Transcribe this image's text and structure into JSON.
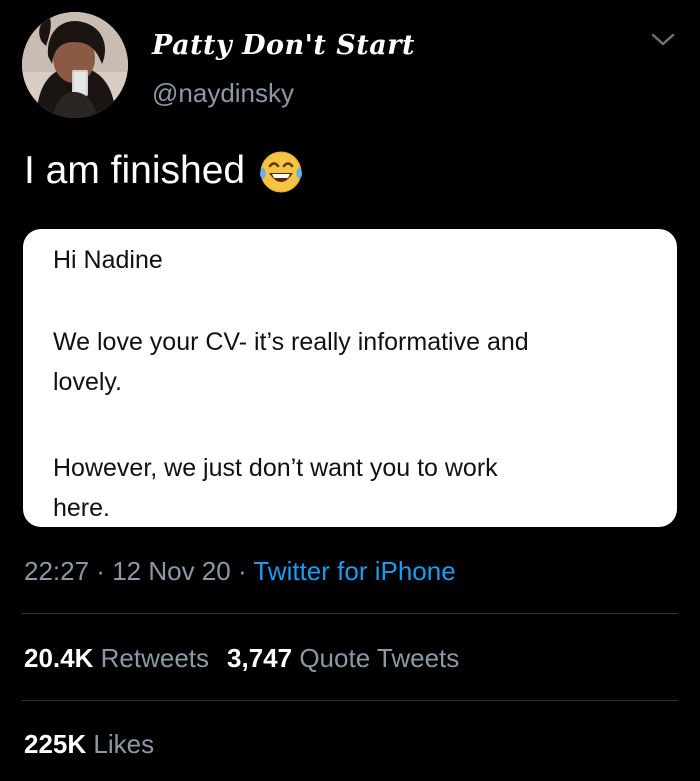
{
  "user": {
    "display_name": "Patty Don't Start",
    "handle": "@naydinsky"
  },
  "tweet": {
    "text": "I am finished",
    "emoji": "face-with-tears-of-joy-icon"
  },
  "media": {
    "lines": [
      "Hi Nadine",
      "We love your CV- it’s really informative and",
      "lovely.",
      "However, we just don’t want you to work",
      "here."
    ]
  },
  "meta": {
    "time": "22:27",
    "sep1": " · ",
    "date": "12 Nov 20",
    "sep2": " · ",
    "source": "Twitter for iPhone"
  },
  "stats": {
    "retweets_count": "20.4K",
    "retweets_label": "Retweets",
    "quotes_count": "3,747",
    "quotes_label": "Quote Tweets",
    "likes_count": "225K",
    "likes_label": "Likes"
  },
  "colors": {
    "background": "#000000",
    "secondary_text": "#8b98a5",
    "link": "#1d9bf0",
    "divider": "#2f3336"
  }
}
